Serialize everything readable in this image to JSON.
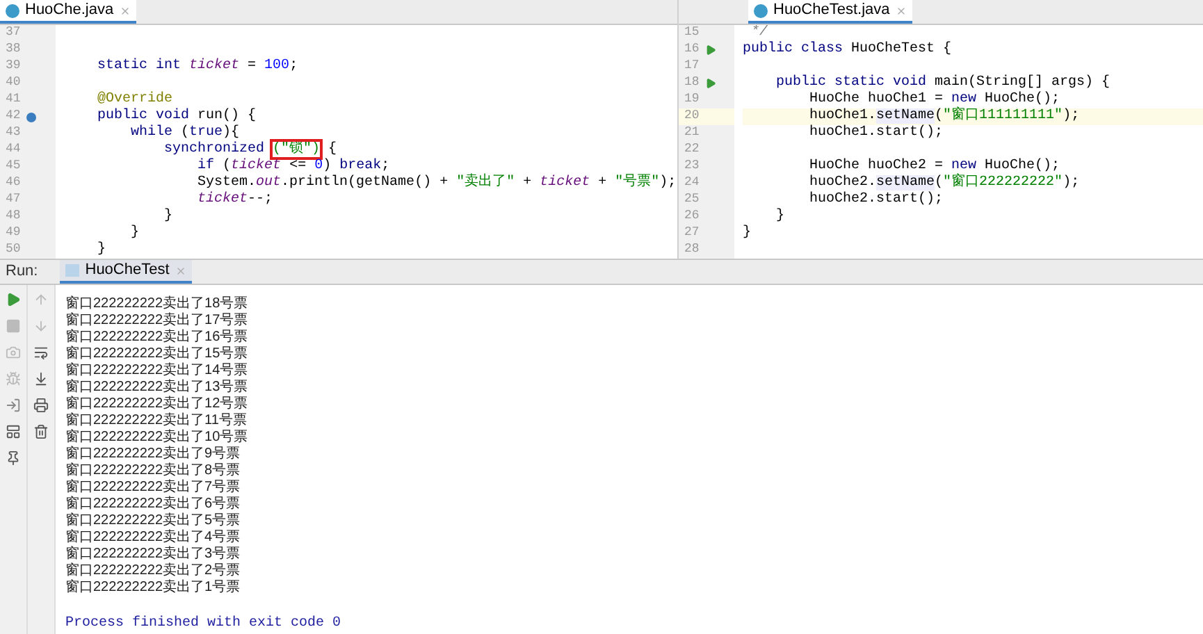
{
  "editors": [
    {
      "tab": {
        "title": "HuoChe.java",
        "selected": true
      },
      "lines": [
        {
          "number": "37"
        },
        {
          "number": "38"
        },
        {
          "number": "39",
          "tokens": [
            {
              "text": "    static int ",
              "kind": "kw"
            },
            {
              "text": "ticket",
              "kind": "static"
            },
            {
              "text": " = ",
              "kind": "plain"
            },
            {
              "text": "100",
              "kind": "num"
            },
            {
              "text": ";",
              "kind": "plain"
            }
          ]
        },
        {
          "number": "40"
        },
        {
          "number": "41",
          "tokens": [
            {
              "text": "    @Override",
              "kind": "ann"
            }
          ]
        },
        {
          "number": "42",
          "override_marker": true,
          "tokens": [
            {
              "text": "    public void ",
              "kind": "kw"
            },
            {
              "text": "run() {",
              "kind": "plain"
            }
          ]
        },
        {
          "number": "43",
          "tokens": [
            {
              "text": "        while ",
              "kind": "kw"
            },
            {
              "text": "(",
              "kind": "plain"
            },
            {
              "text": "true",
              "kind": "kw"
            },
            {
              "text": "){",
              "kind": "plain"
            }
          ]
        },
        {
          "number": "44",
          "tokens": [
            {
              "text": "            synchronized ",
              "kind": "kw"
            },
            {
              "text": "(\"锁\")",
              "kind": "str",
              "boxed": true
            },
            {
              "text": " {",
              "kind": "plain"
            }
          ]
        },
        {
          "number": "45",
          "tokens": [
            {
              "text": "                if ",
              "kind": "kw"
            },
            {
              "text": "(",
              "kind": "plain"
            },
            {
              "text": "ticket",
              "kind": "static"
            },
            {
              "text": " <= ",
              "kind": "plain"
            },
            {
              "text": "0",
              "kind": "num"
            },
            {
              "text": ") ",
              "kind": "plain"
            },
            {
              "text": "break",
              "kind": "kw"
            },
            {
              "text": ";",
              "kind": "plain"
            }
          ]
        },
        {
          "number": "46",
          "tokens": [
            {
              "text": "                System.",
              "kind": "plain"
            },
            {
              "text": "out",
              "kind": "staticfield"
            },
            {
              "text": ".println(getName() + ",
              "kind": "plain"
            },
            {
              "text": "\"卖出了\"",
              "kind": "str"
            },
            {
              "text": " + ",
              "kind": "plain"
            },
            {
              "text": "ticket",
              "kind": "static"
            },
            {
              "text": " + ",
              "kind": "plain"
            },
            {
              "text": "\"号票\"",
              "kind": "str"
            },
            {
              "text": ");",
              "kind": "plain"
            }
          ]
        },
        {
          "number": "47",
          "tokens": [
            {
              "text": "                ticket",
              "kind": "static"
            },
            {
              "text": "--;",
              "kind": "plain"
            }
          ]
        },
        {
          "number": "48",
          "tokens": [
            {
              "text": "            }",
              "kind": "plain"
            }
          ]
        },
        {
          "number": "49",
          "tokens": [
            {
              "text": "        }",
              "kind": "plain"
            }
          ]
        },
        {
          "number": "50",
          "tokens": [
            {
              "text": "    }",
              "kind": "plain"
            }
          ]
        }
      ]
    },
    {
      "tab": {
        "title": "HuoCheTest.java",
        "selected": true
      },
      "lines": [
        {
          "number": "15",
          "tokens": [
            {
              "text": " */",
              "kind": "comment"
            }
          ]
        },
        {
          "number": "16",
          "run_marker": true,
          "tokens": [
            {
              "text": "public class ",
              "kind": "kw"
            },
            {
              "text": "HuoCheTest {",
              "kind": "plain"
            }
          ]
        },
        {
          "number": "17"
        },
        {
          "number": "18",
          "run_marker": true,
          "tokens": [
            {
              "text": "    public static void ",
              "kind": "kw"
            },
            {
              "text": "main(String[] args) {",
              "kind": "plain"
            }
          ]
        },
        {
          "number": "19",
          "tokens": [
            {
              "text": "        HuoChe huoChe1 = ",
              "kind": "plain"
            },
            {
              "text": "new ",
              "kind": "kw"
            },
            {
              "text": "HuoChe();",
              "kind": "plain"
            }
          ]
        },
        {
          "number": "20",
          "current": true,
          "tokens": [
            {
              "text": "        huoChe1.",
              "kind": "plain"
            },
            {
              "text": "setName",
              "kind": "method"
            },
            {
              "text": "(",
              "kind": "plain"
            },
            {
              "text": "\"窗口111111111\"",
              "kind": "str"
            },
            {
              "text": ");",
              "kind": "plain"
            }
          ]
        },
        {
          "number": "21",
          "tokens": [
            {
              "text": "        huoChe1.start();",
              "kind": "plain"
            }
          ]
        },
        {
          "number": "22"
        },
        {
          "number": "23",
          "tokens": [
            {
              "text": "        HuoChe huoChe2 = ",
              "kind": "plain"
            },
            {
              "text": "new ",
              "kind": "kw"
            },
            {
              "text": "HuoChe();",
              "kind": "plain"
            }
          ]
        },
        {
          "number": "24",
          "tokens": [
            {
              "text": "        huoChe2.",
              "kind": "plain"
            },
            {
              "text": "setName",
              "kind": "method"
            },
            {
              "text": "(",
              "kind": "plain"
            },
            {
              "text": "\"窗口222222222\"",
              "kind": "str"
            },
            {
              "text": ");",
              "kind": "plain"
            }
          ]
        },
        {
          "number": "25",
          "tokens": [
            {
              "text": "        huoChe2.start();",
              "kind": "plain"
            }
          ]
        },
        {
          "number": "26",
          "tokens": [
            {
              "text": "    }",
              "kind": "plain"
            }
          ]
        },
        {
          "number": "27",
          "tokens": [
            {
              "text": "}",
              "kind": "plain"
            }
          ]
        },
        {
          "number": "28"
        }
      ]
    }
  ],
  "run_panel": {
    "label": "Run:",
    "tab": {
      "title": "HuoCheTest",
      "selected": true
    },
    "output": [
      "窗口222222222卖出了18号票",
      "窗口222222222卖出了17号票",
      "窗口222222222卖出了16号票",
      "窗口222222222卖出了15号票",
      "窗口222222222卖出了14号票",
      "窗口222222222卖出了13号票",
      "窗口222222222卖出了12号票",
      "窗口222222222卖出了11号票",
      "窗口222222222卖出了10号票",
      "窗口222222222卖出了9号票",
      "窗口222222222卖出了8号票",
      "窗口222222222卖出了7号票",
      "窗口222222222卖出了6号票",
      "窗口222222222卖出了5号票",
      "窗口222222222卖出了4号票",
      "窗口222222222卖出了3号票",
      "窗口222222222卖出了2号票",
      "窗口222222222卖出了1号票"
    ],
    "exit_message": "Process finished with exit code 0"
  }
}
